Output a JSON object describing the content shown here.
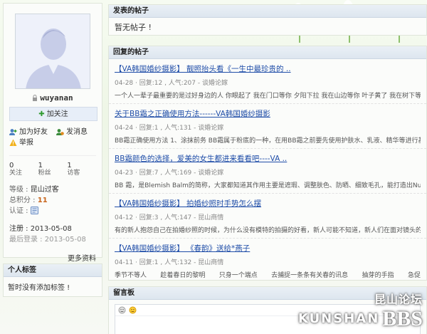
{
  "profile": {
    "username": "wuyanan",
    "follow_label": "加关注",
    "actions": {
      "add_friend": "加为好友",
      "message": "发消息",
      "report": "举报"
    },
    "stats": [
      {
        "count": "0",
        "label": "关注"
      },
      {
        "count": "1",
        "label": "粉丝"
      },
      {
        "count": "1",
        "label": "访客"
      }
    ],
    "level_label": "等级 : ",
    "level_value": "昆山过客",
    "points_label": "总积分 : ",
    "points_value": "11",
    "verify_label": "认证 : ",
    "register_label": "注册 : ",
    "register_date": "2013-05-08",
    "last_login_label": "最后登录 : ",
    "last_login_date": "2013-05-08",
    "more_label": "更多资料"
  },
  "tags": {
    "title": "个人标签",
    "empty_text": "暂时没有添加标签 !"
  },
  "posted": {
    "title": "发表的帖子",
    "empty_text": "暂无帖子 !"
  },
  "replied": {
    "title": "回复的帖子",
    "posts": [
      {
        "title": "【VA韩国婚纱摄影】 靓照抬头看《一生中最珍贵的 ..",
        "info": "04-28 · 回复:12 , 人气:207 - 谈婚论嫁",
        "excerpt": "一个人一辈子最重要的是过好身边的人 你眼起了 我在门口等你 夕阳下拉 我在山边等你 叶子黄了 我在树下等"
      },
      {
        "title": "关于BB霜之正确使用方法------VA韩国婚纱摄影",
        "info": "04-24 · 回复:1 , 人气:131 - 谈婚论嫁",
        "excerpt": "BB霜正确使用方法 1、涂抹前务 BB霜属于粉底的一种，在用BB霜之前要先使用护肤水、乳液、精华等进行基"
      },
      {
        "title": "BB霜颜色的选择，爱美的女生都进来看看吧----VA ..",
        "info": "04-23 · 回复:7 , 人气:169 - 谈婚论嫁",
        "excerpt": "BB 霜，是Blemish Balm的简称，大家都知道其作用主要是遮瑕、调整肤色、防晒、细致毛孔，能打造出Nude Look"
      },
      {
        "title": "【VA韩国婚纱摄影】 拍婚纱照时手势怎么摆",
        "info": "04-12 · 回复:3 , 人气:147 - 昆山商情",
        "excerpt": "有的新人抱怨自己在拍婚纱照的时候，为什么没有模特的拍摄的好看，新人可能不知道，新人们在面对镜头的时"
      },
      {
        "title": "【VA韩国婚纱摄影】 《春韵》送给*燕子",
        "info": "04-11 · 回复:1 , 人气:132 - 昆山商情",
        "excerpt_parts": [
          "季节不等人",
          "趁着春日的黎明",
          "只身一个端点",
          "去捕捉一条条有关春的讯息",
          "抽芽的手指",
          "急促"
        ]
      }
    ]
  },
  "guestbook": {
    "title": "留言板"
  },
  "watermark": {
    "cn": "昆山论坛",
    "en": "KUNSHAN",
    "bbs": "BBS"
  }
}
